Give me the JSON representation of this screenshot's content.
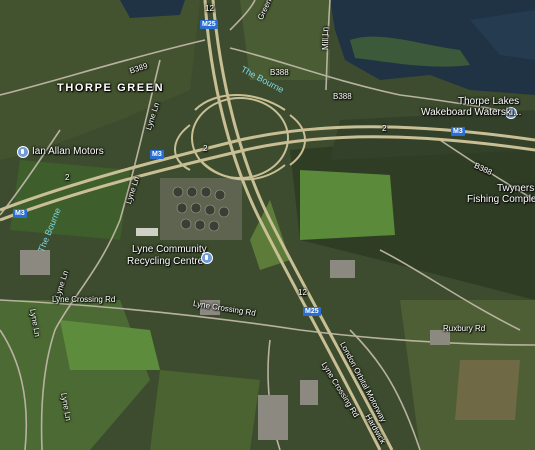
{
  "places": {
    "thorpe_green": "THORPE GREEN",
    "ian_allan": "Ian Allan Motors",
    "thorpe_lakes_line1": "Thorpe Lakes",
    "thorpe_lakes_line2": "Wakeboard Waterski...",
    "twynersh_line1": "Twynersh",
    "twynersh_line2": "Fishing Complex",
    "lyne_recycling_line1": "Lyne Community",
    "lyne_recycling_line2": "Recycling Centre",
    "ruxbury": "Ruxbury Rd"
  },
  "roads": {
    "b389": "B389",
    "b388_a": "B388",
    "b388_b": "B388",
    "b388_c": "B388",
    "the_bourne_a": "The Bourne",
    "the_bourne_b": "The Bourne",
    "mill_ln": "Mill Ln",
    "green": "Green",
    "lyne_ln_a": "Lyne Ln",
    "lyne_ln_b": "Lyne Ln",
    "lyne_ln_c": "Lyne Ln",
    "lyne_ln_d": "Lyne Ln",
    "lyne_ln_e": "Lyne Ln",
    "lyne_crossing_a": "Lyne Crossing Rd",
    "lyne_crossing_b": "Lyne Crossing Rd",
    "lyne_crossing_c": "Lyne Crossing Rd",
    "london_orbital": "London Orbital Motorway",
    "hardwick": "Hardwick",
    "num_2_a": "2",
    "num_2_b": "2",
    "num_2_c": "2",
    "num_12_a": "12",
    "num_12_b": "12"
  },
  "shields": {
    "m25_top": "M25",
    "m25_bottom": "M25",
    "m3_center": "M3",
    "m3_left": "M3",
    "m3_right": "M3"
  },
  "colors": {
    "shield": "#2b6ed2",
    "water": "#1f3344",
    "motorway": "#c9bf95"
  }
}
